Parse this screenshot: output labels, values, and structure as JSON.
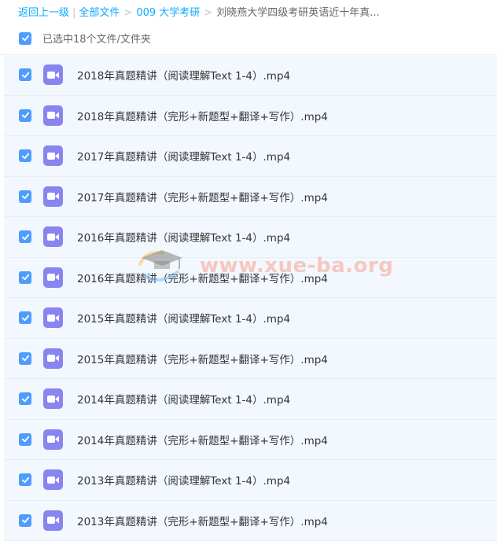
{
  "breadcrumb": {
    "back": "返回上一级",
    "all_files": "全部文件",
    "folder1": "009 大学考研",
    "current": "刘晓燕大学四级考研英语近十年真..."
  },
  "selection": {
    "label": "已选中18个文件/文件夹",
    "checked": true
  },
  "colors": {
    "accent": "#4e9cff",
    "link": "#09aaff",
    "video_icon": "#8884f0",
    "row_bg": "#f2f8fe"
  },
  "files": [
    {
      "name": "2018年真题精讲（阅读理解Text 1-4）.mp4",
      "icon": "video-file-icon",
      "checked": true
    },
    {
      "name": "2018年真题精讲（完形+新题型+翻译+写作）.mp4",
      "icon": "video-file-icon",
      "checked": true
    },
    {
      "name": "2017年真题精讲（阅读理解Text 1-4）.mp4",
      "icon": "video-file-icon",
      "checked": true
    },
    {
      "name": "2017年真题精讲（完形+新题型+翻译+写作）.mp4",
      "icon": "video-file-icon",
      "checked": true
    },
    {
      "name": "2016年真题精讲（阅读理解Text 1-4）.mp4",
      "icon": "video-file-icon",
      "checked": true
    },
    {
      "name": "2016年真题精讲（完形+新题型+翻译+写作）.mp4",
      "icon": "video-file-icon",
      "checked": true
    },
    {
      "name": "2015年真题精讲（阅读理解Text 1-4）.mp4",
      "icon": "video-file-icon",
      "checked": true
    },
    {
      "name": "2015年真题精讲（完形+新题型+翻译+写作）.mp4",
      "icon": "video-file-icon",
      "checked": true
    },
    {
      "name": "2014年真题精讲（阅读理解Text 1-4）.mp4",
      "icon": "video-file-icon",
      "checked": true
    },
    {
      "name": "2014年真题精讲（完形+新题型+翻译+写作）.mp4",
      "icon": "video-file-icon",
      "checked": true
    },
    {
      "name": "2013年真题精讲（阅读理解Text 1-4）.mp4",
      "icon": "video-file-icon",
      "checked": true
    },
    {
      "name": "2013年真题精讲（完形+新题型+翻译+写作）.mp4",
      "icon": "video-file-icon",
      "checked": true
    }
  ],
  "watermark": {
    "text": "www.xue-ba.org"
  }
}
